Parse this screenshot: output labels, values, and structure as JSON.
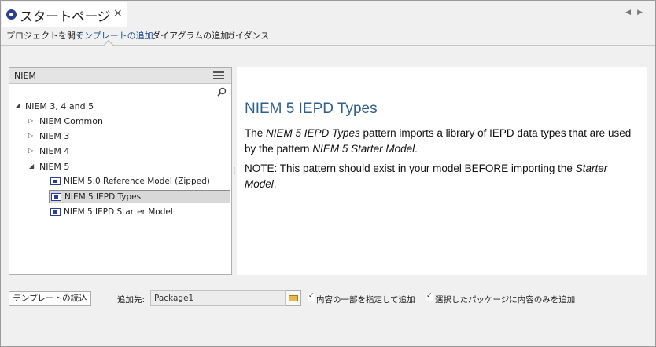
{
  "window": {
    "tab_title": "スタートページ",
    "close_glyph": "×",
    "nav_arrows": "◀▶"
  },
  "subtabs": [
    {
      "label": "プロジェクトを開く",
      "active": false
    },
    {
      "label": "テンプレートの追加",
      "active": true
    },
    {
      "label": "ダイアグラムの追加",
      "active": false
    },
    {
      "label": "ガイダンス",
      "active": false
    }
  ],
  "left_panel": {
    "header": "NIEM",
    "tree": {
      "root": "NIEM 3, 4 and 5",
      "children": [
        "NIEM Common",
        "NIEM 3",
        "NIEM 4",
        "NIEM 5"
      ],
      "niem5_items": [
        "NIEM 5.0 Reference Model (Zipped)",
        "NIEM 5 IEPD Types",
        "NIEM 5 IEPD Starter Model"
      ],
      "selected": "NIEM 5 IEPD Types"
    }
  },
  "description": {
    "title": "NIEM 5 IEPD Types",
    "p1_a": "The ",
    "p1_em1": "NIEM 5 IEPD Types",
    "p1_b": " pattern imports a library of IEPD data types that are used by the pattern ",
    "p1_em2": "NIEM 5 Starter Model",
    "p1_c": ".",
    "p2_a": "NOTE:  This pattern should exist in your model BEFORE importing the ",
    "p2_em": "Starter Model",
    "p2_b": "."
  },
  "bottom": {
    "load_button": "テンプレートの読込",
    "add_to_label": "追加先:",
    "add_to_value": "Package1",
    "check1_label": "内容の一部を指定して追加",
    "check1_checked": true,
    "check2_label": "選択したパッケージに内容のみを追加",
    "check2_checked": true
  },
  "colors": {
    "title_blue": "#2e5f8f",
    "active_tab": "#1f4e8c",
    "logo": "#2d3f8c"
  },
  "icons": [
    "logo-icon",
    "close-icon",
    "menu-icon",
    "search-icon",
    "expand-arrow-icon",
    "collapse-arrow-icon",
    "package-icon",
    "folder-icon",
    "checkbox-icon"
  ]
}
